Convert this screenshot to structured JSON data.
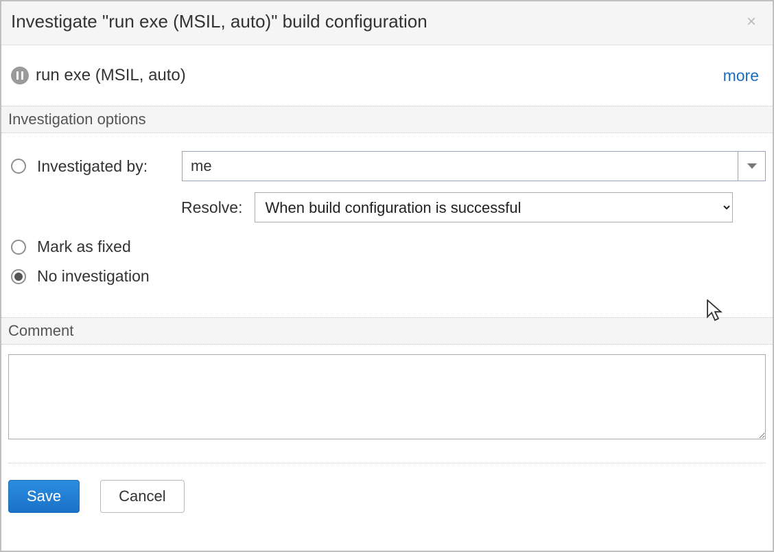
{
  "dialog": {
    "title": "Investigate \"run exe (MSIL, auto)\" build configuration"
  },
  "config": {
    "icon": "pause-icon",
    "name": "run exe (MSIL, auto)",
    "more_label": "more"
  },
  "sections": {
    "investigation_header": "Investigation options",
    "comment_header": "Comment"
  },
  "options": {
    "investigated_by": {
      "label": "Investigated by:",
      "value": "me"
    },
    "resolve": {
      "label": "Resolve:",
      "value": "When build configuration is successful"
    },
    "mark_fixed_label": "Mark as fixed",
    "no_investigation_label": "No investigation",
    "selected": "no_investigation"
  },
  "comment": {
    "value": ""
  },
  "footer": {
    "save_label": "Save",
    "cancel_label": "Cancel"
  }
}
